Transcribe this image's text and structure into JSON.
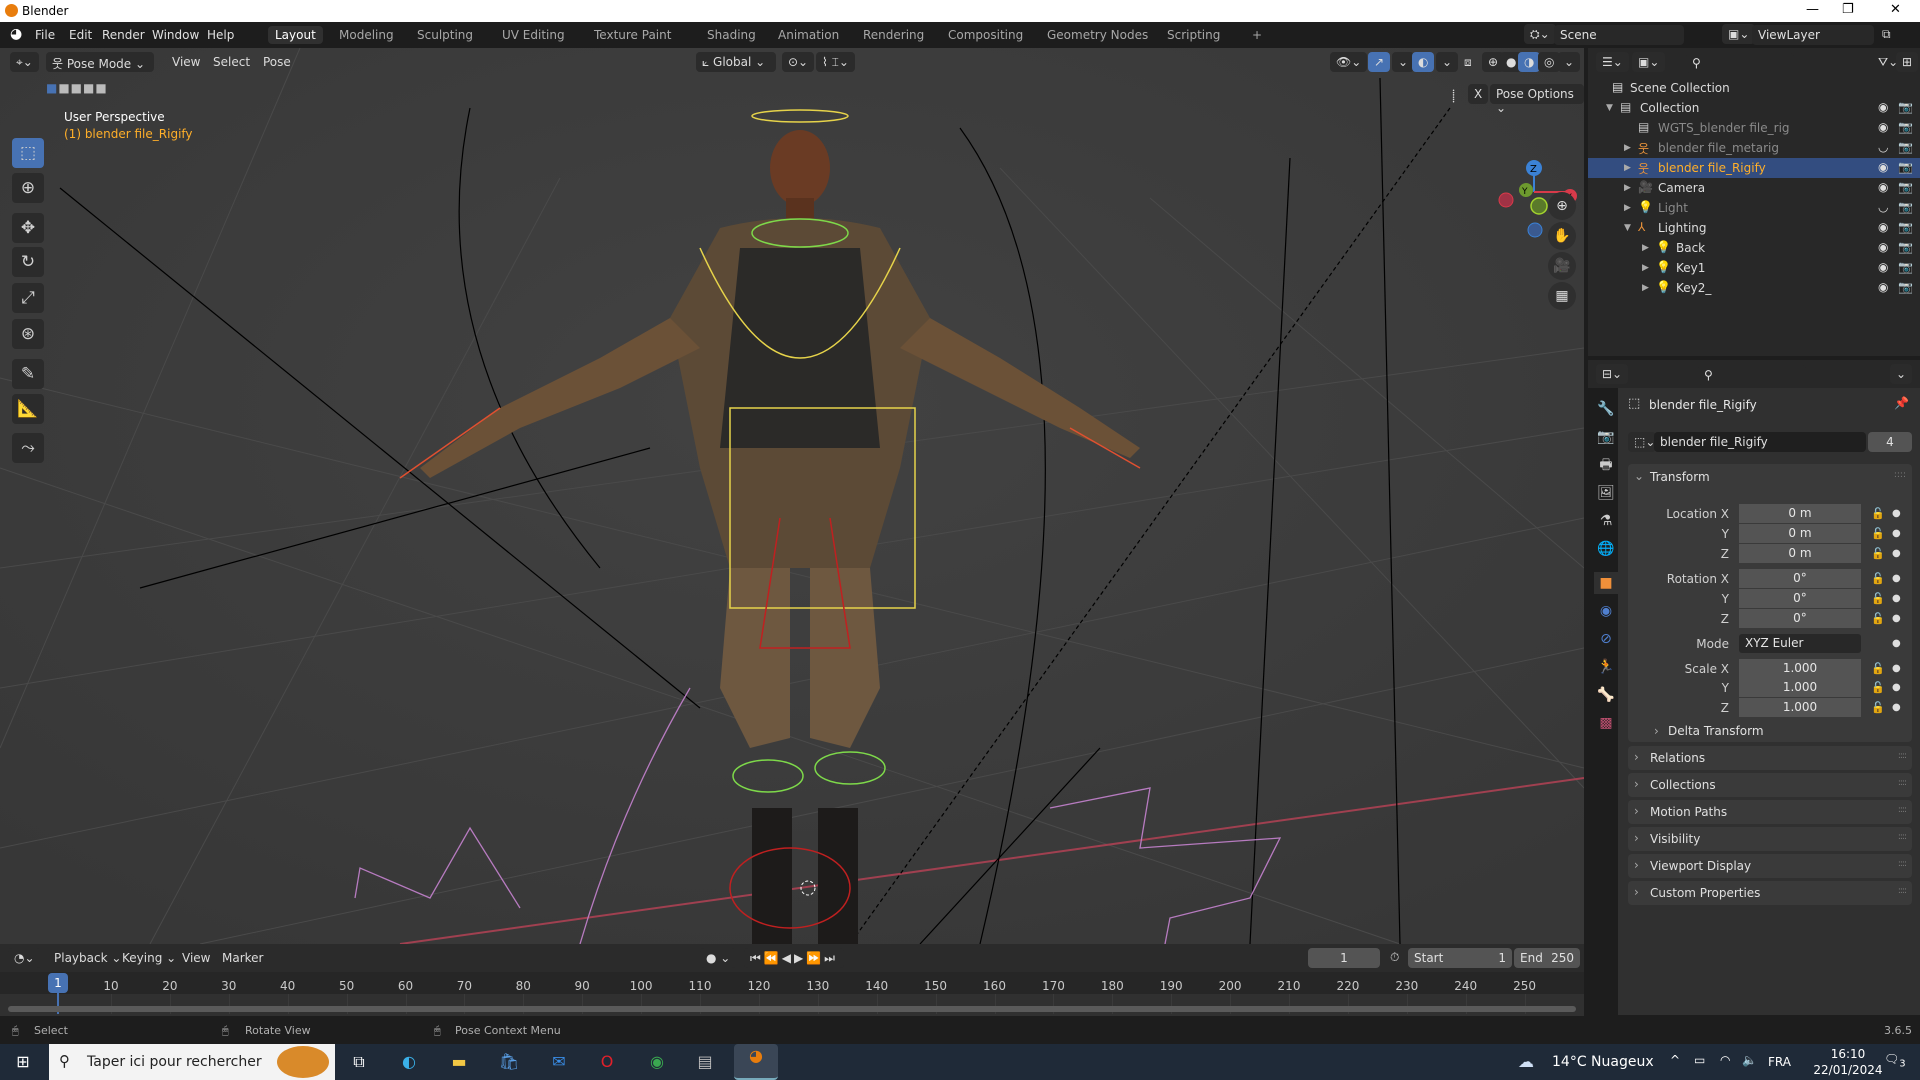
{
  "window": {
    "title": "Blender",
    "controls": [
      "—",
      "❐",
      "✕"
    ]
  },
  "menu": [
    "File",
    "Edit",
    "Render",
    "Window",
    "Help"
  ],
  "workspaces": [
    "Layout",
    "Modeling",
    "Sculpting",
    "UV Editing",
    "Texture Paint",
    "Shading",
    "Animation",
    "Rendering",
    "Compositing",
    "Geometry Nodes",
    "Scripting",
    "+"
  ],
  "active_workspace": "Layout",
  "scene": {
    "name": "Scene",
    "view_layer": "ViewLayer"
  },
  "viewport_header": {
    "mode": "Pose Mode",
    "menus": [
      "View",
      "Select",
      "Pose"
    ],
    "orientation": "Global",
    "pose_options": "Pose Options",
    "x_mirror": "X"
  },
  "viewport": {
    "perspective": "User Perspective",
    "object_info": "(1) blender file_Rigify",
    "gizmo_axes": [
      "Z",
      "Y",
      "X"
    ]
  },
  "tools": [
    "select-box",
    "cursor",
    "move",
    "rotate",
    "scale",
    "transform",
    "annotate",
    "measure",
    "bone-roll"
  ],
  "outliner": {
    "root": "Scene Collection",
    "items": [
      {
        "label": "Collection",
        "indent": 1,
        "icon": "collection",
        "state": "normal"
      },
      {
        "label": "WGTS_blender file_rig",
        "indent": 2,
        "icon": "collection",
        "state": "dim"
      },
      {
        "label": "blender file_metarig",
        "indent": 2,
        "icon": "armature",
        "state": "dim"
      },
      {
        "label": "blender file_Rigify",
        "indent": 2,
        "icon": "armature",
        "state": "selected"
      },
      {
        "label": "Camera",
        "indent": 2,
        "icon": "camera",
        "state": "normal"
      },
      {
        "label": "Light",
        "indent": 2,
        "icon": "light",
        "state": "dim"
      },
      {
        "label": "Lighting",
        "indent": 2,
        "icon": "empty",
        "state": "normal"
      },
      {
        "label": "Back",
        "indent": 3,
        "icon": "light",
        "state": "normal"
      },
      {
        "label": "Key1",
        "indent": 3,
        "icon": "light",
        "state": "normal"
      },
      {
        "label": "Key2_",
        "indent": 3,
        "icon": "light",
        "state": "normal"
      }
    ]
  },
  "properties": {
    "object_name": "blender file_Rigify",
    "data_name": "blender file_Rigify",
    "users": "4",
    "transform_label": "Transform",
    "rows": [
      {
        "label": "Location X",
        "value": "0 m"
      },
      {
        "label": "Y",
        "value": "0 m"
      },
      {
        "label": "Z",
        "value": "0 m"
      },
      {
        "label": "Rotation X",
        "value": "0°"
      },
      {
        "label": "Y",
        "value": "0°"
      },
      {
        "label": "Z",
        "value": "0°"
      },
      {
        "label": "Mode",
        "value": "XYZ Euler"
      },
      {
        "label": "Scale X",
        "value": "1.000"
      },
      {
        "label": "Y",
        "value": "1.000"
      },
      {
        "label": "Z",
        "value": "1.000"
      }
    ],
    "delta_transform": "Delta Transform",
    "panels": [
      "Relations",
      "Collections",
      "Motion Paths",
      "Visibility",
      "Viewport Display",
      "Custom Properties"
    ]
  },
  "timeline": {
    "menus": [
      "Playback",
      "Keying",
      "View",
      "Marker"
    ],
    "current_frame": "1",
    "start_label": "Start",
    "start": "1",
    "end_label": "End",
    "end": "250",
    "ticks": [
      "10",
      "20",
      "30",
      "40",
      "50",
      "60",
      "70",
      "80",
      "90",
      "100",
      "110",
      "120",
      "130",
      "140",
      "150",
      "160",
      "170",
      "180",
      "190",
      "200",
      "210",
      "220",
      "230",
      "240",
      "250"
    ],
    "playhead": "1"
  },
  "statusbar": {
    "hints": [
      "Select",
      "Rotate View",
      "Pose Context Menu"
    ],
    "version": "3.6.5"
  },
  "taskbar": {
    "search_placeholder": "Taper ici pour rechercher",
    "weather": "14°C  Nuageux",
    "language": "FRA",
    "time": "16:10",
    "date": "22/01/2024",
    "notifications": "3"
  },
  "colors": {
    "accent": "#4772b3",
    "selected_text": "#ffaf29",
    "viewport_bg": "#3d3d3d"
  }
}
